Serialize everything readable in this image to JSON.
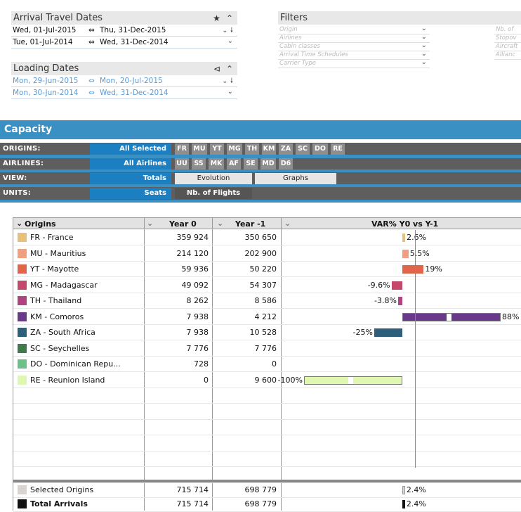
{
  "arrival": {
    "title": "Arrival Travel Dates",
    "icons": [
      "star-icon",
      "chevron-up-icon"
    ],
    "rows": [
      {
        "from": "Wed, 01-Jul-2015",
        "arrow": "⇔",
        "to": "Thu,  31-Dec-2015"
      },
      {
        "from": "Tue,  01-Jul-2014",
        "arrow": "⇔",
        "to": "Wed, 31-Dec-2014"
      }
    ]
  },
  "loading": {
    "title": "Loading Dates",
    "rows": [
      {
        "from": "Mon, 29-Jun-2015",
        "arrow": "⇔",
        "to": "Mon, 20-Jul-2015"
      },
      {
        "from": "Mon, 30-Jun-2014",
        "arrow": "⇔",
        "to": "Wed, 31-Dec-2014"
      }
    ]
  },
  "filters": {
    "title": "Filters",
    "left": [
      "Origin",
      "Airlines",
      "Cabin classes",
      "Arrival Time Schedules",
      "Carrier Type"
    ],
    "right": [
      "Nb. of",
      "Stopov",
      "Aircraft",
      "Allianc"
    ]
  },
  "capacity": {
    "title": "Capacity",
    "origins": {
      "label": "ORIGINS:",
      "selected": "All Selected",
      "chips": [
        "FR",
        "MU",
        "YT",
        "MG",
        "TH",
        "KM",
        "ZA",
        "SC",
        "DO",
        "RE"
      ]
    },
    "airlines": {
      "label": "AIRLINES:",
      "selected": "All Airlines",
      "chips": [
        "UU",
        "SS",
        "MK",
        "AF",
        "SE",
        "MD",
        "D6"
      ]
    },
    "view": {
      "label": "VIEW:",
      "selected": "Totals",
      "options": [
        "Evolution",
        "Graphs"
      ]
    },
    "units": {
      "label": "UNITS:",
      "selected": "Seats",
      "options": [
        "Nb. of Flights"
      ]
    }
  },
  "table": {
    "headers": {
      "origins": "Origins",
      "y0": "Year 0",
      "y1": "Year -1",
      "var": "VAR% Y0 vs Y-1"
    },
    "rows": [
      {
        "name": "FR - France",
        "color": "#e8c07a",
        "y0": "359 924",
        "y1": "350 650",
        "pct": "2.6%",
        "var": 2.6
      },
      {
        "name": "MU - Mauritius",
        "color": "#f0a080",
        "y0": "214 120",
        "y1": "202 900",
        "pct": "5.5%",
        "var": 5.5
      },
      {
        "name": "YT - Mayotte",
        "color": "#e0654a",
        "y0": "59 936",
        "y1": "50 220",
        "pct": "19%",
        "var": 19
      },
      {
        "name": "MG - Madagascar",
        "color": "#c34a6a",
        "y0": "49 092",
        "y1": "54 307",
        "pct": "-9.6%",
        "var": -9.6
      },
      {
        "name": "TH - Thailand",
        "color": "#b0457e",
        "y0": "8 262",
        "y1": "8 586",
        "pct": "-3.8%",
        "var": -3.8
      },
      {
        "name": "KM - Comoros",
        "color": "#6a3a8a",
        "y0": "7 938",
        "y1": "4 212",
        "pct": "88%",
        "var": 88
      },
      {
        "name": "ZA - South Africa",
        "color": "#2e5f7a",
        "y0": "7 938",
        "y1": "10 528",
        "pct": "-25%",
        "var": -25
      },
      {
        "name": "SC - Seychelles",
        "color": "#3e7a4e",
        "y0": "7 776",
        "y1": "7 776",
        "pct": "",
        "var": 0
      },
      {
        "name": "DO - Dominican Repu...",
        "color": "#6cc08a",
        "y0": "728",
        "y1": "0",
        "pct": "",
        "var": null
      },
      {
        "name": "RE - Reunion Island",
        "color": "#dff7b0",
        "y0": "0",
        "y1": "9 600",
        "pct": "-100%",
        "var": -100
      }
    ],
    "totals": [
      {
        "name": "Selected Origins",
        "color": "#d8d4d2",
        "y0": "715 714",
        "y1": "698 779",
        "pct": "2.4%",
        "var": 2.4,
        "bold": false
      },
      {
        "name": "Total Arrivals",
        "color": "#111111",
        "y0": "715 714",
        "y1": "698 779",
        "pct": "2.4%",
        "var": 2.4,
        "bold": true
      }
    ]
  }
}
